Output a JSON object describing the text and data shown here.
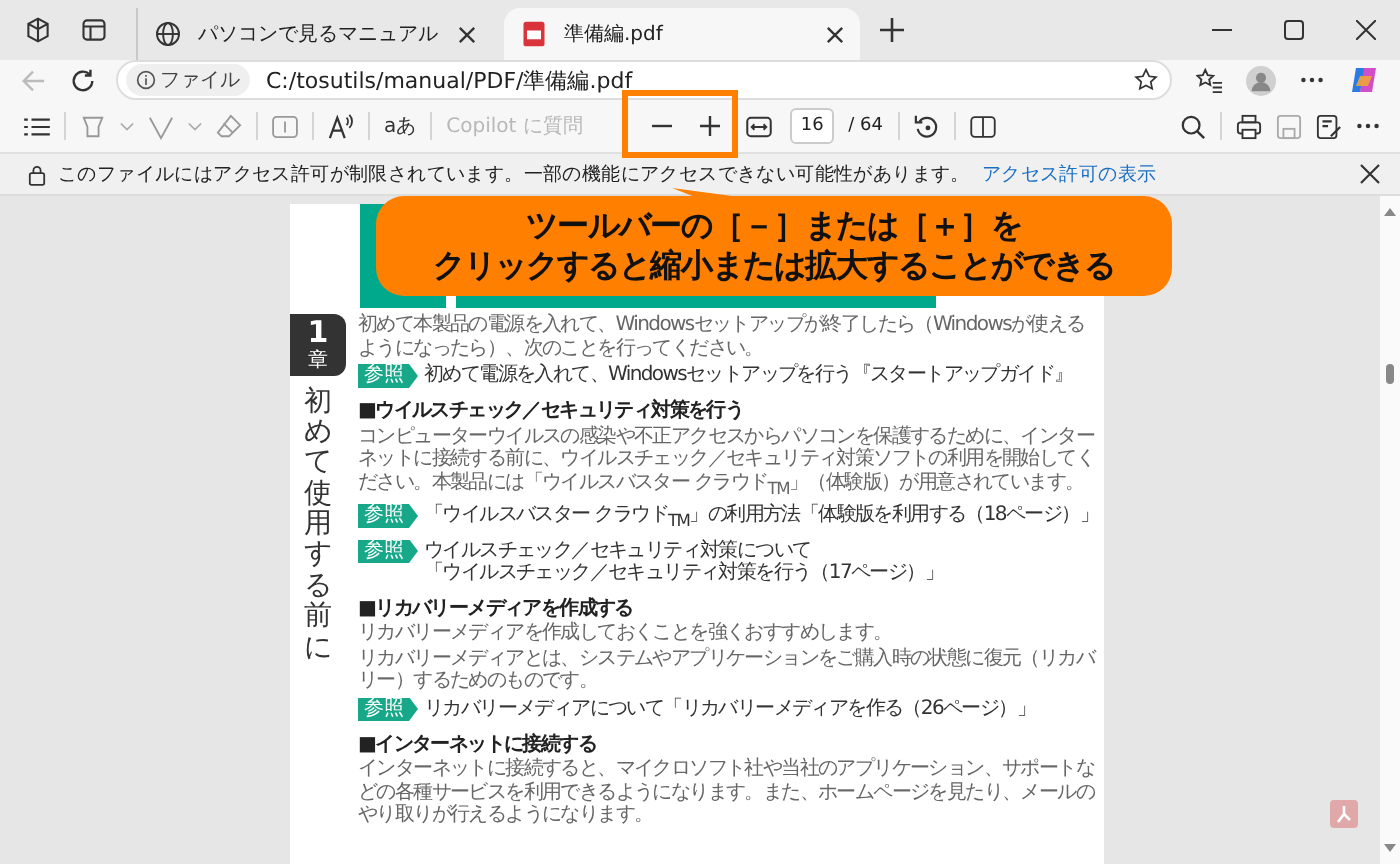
{
  "browser_tabs": [
    {
      "title": "パソコンで見るマニュアル",
      "kind": "globe",
      "selected": false
    },
    {
      "title": "準備編.pdf",
      "kind": "pdf",
      "selected": true
    }
  ],
  "address_bar": {
    "chip": "ファイル",
    "url": "C:/tosutils/manual/PDF/準備編.pdf"
  },
  "pdf_toolbar": {
    "translate_label": "aあ",
    "copilot_placeholder": "Copilot に質問",
    "page_number": "16",
    "page_total": "/ 64"
  },
  "info_bar": {
    "message": "このファイルにはアクセス許可が制限されています。一部の機能にアクセスできない可能性があります。",
    "link": "アクセス許可の表示"
  },
  "document": {
    "chapter_number": "1",
    "chapter_label": "章",
    "chapter_title": "初めて使用する前に",
    "blocks": [
      {
        "kind": "paragraph",
        "text": "初めて本製品の電源を入れて、Windowsセットアップが終了したら（Windowsが使えるようになったら）、次のことを行ってください。"
      },
      {
        "kind": "reference",
        "badge": "参照",
        "lines": [
          "初めて電源を入れて、Windowsセットアップを行う『スタートアップガイド』"
        ]
      },
      {
        "kind": "heading",
        "text": "■ウイルスチェック／セキュリティ対策を行う"
      },
      {
        "kind": "paragraph",
        "text": "コンピューターウイルスの感染や不正アクセスからパソコンを保護するために、インターネットに接続する前に、ウイルスチェック／セキュリティ対策ソフトの利用を開始してください。本製品には「ウイルスバスター クラウド$_{TM}$」（体験版）が用意されています。"
      },
      {
        "kind": "reference",
        "badge": "参照",
        "lines": [
          "「ウイルスバスター クラウド$_{TM}$」の利用方法「体験版を利用する（18ページ）」"
        ]
      },
      {
        "kind": "reference",
        "badge": "参照",
        "lines": [
          "ウイルスチェック／セキュリティ対策について",
          "「ウイルスチェック／セキュリティ対策を行う（17ページ）」"
        ]
      },
      {
        "kind": "heading",
        "text": "■リカバリーメディアを作成する"
      },
      {
        "kind": "paragraph",
        "text": "リカバリーメディアを作成しておくことを強くおすすめします。"
      },
      {
        "kind": "paragraph",
        "text": "リカバリーメディアとは、システムやアプリケーションをご購入時の状態に復元（リカバリー）するためのものです。"
      },
      {
        "kind": "reference",
        "badge": "参照",
        "lines": [
          "リカバリーメディアについて「リカバリーメディアを作る（26ページ）」"
        ]
      },
      {
        "kind": "heading",
        "text": "■インターネットに接続する"
      },
      {
        "kind": "paragraph",
        "text": "インターネットに接続すると、マイクロソフト社や当社のアプリケーション、サポートなどの各種サービスを利用できるようになります。また、ホームページを見たり、メールのやり取りが行えるようになります。"
      }
    ]
  },
  "callout": {
    "lines": [
      "ツールバーの［－］または［＋］を",
      "クリックすると縮小または拡大することができる"
    ]
  }
}
